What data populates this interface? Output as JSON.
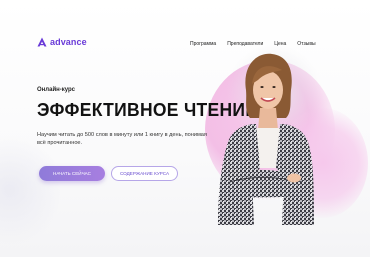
{
  "header": {
    "logo_text": "advance",
    "logo_icon": "advance-logo-icon",
    "nav": [
      "Программа",
      "Преподаватели",
      "Цена",
      "Отзывы"
    ]
  },
  "hero": {
    "eyebrow": "Онлайн-курс",
    "title": "ЭФФЕКТИВНОЕ ЧТЕНИЕ",
    "description": "Научим читать до 500 слов в минуту или 1 книгу в день, понимая всё прочитанное.",
    "primary_button": "НАЧАТЬ СЕЙЧАС",
    "secondary_button": "СОДЕРЖАНИЕ КУРСА"
  },
  "colors": {
    "brand": "#6a3bd8",
    "button_gradient_start": "#8f7bd9",
    "button_gradient_end": "#a77ee0",
    "blob_pink": "#f3bfe6"
  }
}
